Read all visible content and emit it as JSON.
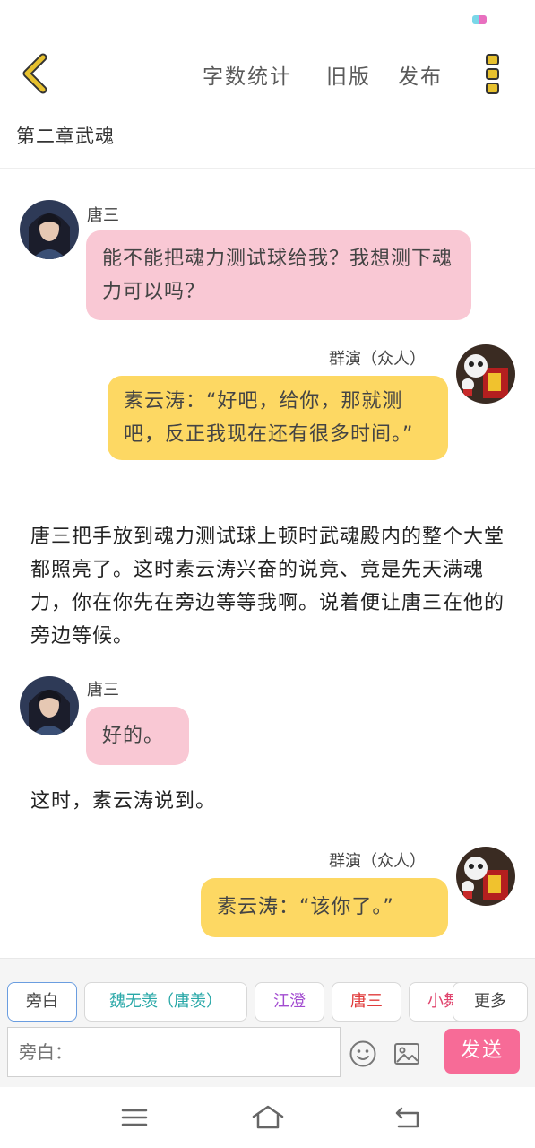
{
  "top_bar": {
    "word_count": "字数统计",
    "old_version": "旧版",
    "publish": "发布"
  },
  "chapter": {
    "title": "第二章武魂"
  },
  "messages": {
    "m1": {
      "speaker": "唐三",
      "text": "能不能把魂力测试球给我？我想测下魂力可以吗？"
    },
    "m2": {
      "speaker": "群演（众人）",
      "text": "素云涛：“好吧，给你，那就测吧，反正我现在还有很多时间。”"
    },
    "m3": {
      "text": "唐三把手放到魂力测试球上顿时武魂殿内的整个大堂都照亮了。这时素云涛兴奋的说竟、竟是先天满魂力，你在你先在旁边等等我啊。说着便让唐三在他的旁边等候。"
    },
    "m4": {
      "speaker": "唐三",
      "text": "好的。"
    },
    "m5": {
      "text": "这时，素云涛说到。"
    },
    "m6": {
      "speaker": "群演（众人）",
      "text": "素云涛：“该你了。”"
    }
  },
  "roles": [
    {
      "label": "旁白",
      "color": "#444444"
    },
    {
      "label": "魏无羡（唐羡）",
      "color": "#2aa8a8"
    },
    {
      "label": "江澄",
      "color": "#a24bd0"
    },
    {
      "label": "唐三",
      "color": "#e03b3b"
    },
    {
      "label": "小舞",
      "color": "#e0456e"
    }
  ],
  "more_roles": "更多",
  "composer": {
    "placeholder": "旁白：",
    "send_label": "发送"
  },
  "colors": {
    "pink_bubble": "#f9c8d4",
    "yellow_bubble": "#fdd863",
    "send_button": "#f76b97",
    "accent_icon": "#e7c12e"
  }
}
